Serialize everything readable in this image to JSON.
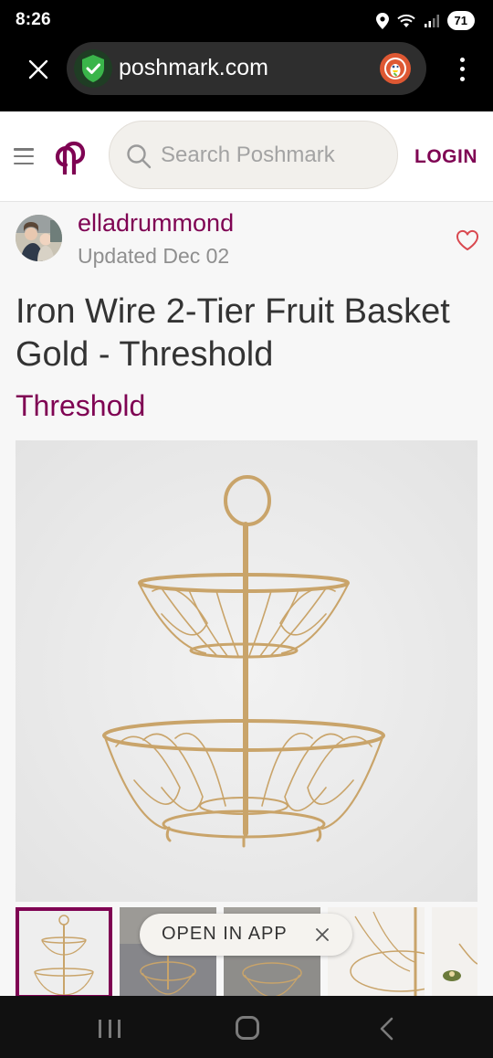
{
  "status_bar": {
    "time": "8:26",
    "battery": "71"
  },
  "browser": {
    "url": "poshmark.com"
  },
  "header": {
    "search_placeholder": "Search Poshmark",
    "login_label": "LOGIN"
  },
  "seller": {
    "username": "elladrummond",
    "updated": "Updated Dec 02"
  },
  "listing": {
    "title": "Iron Wire 2-Tier Fruit Basket Gold - Threshold",
    "brand": "Threshold"
  },
  "open_app": {
    "label": "OPEN IN APP"
  },
  "colors": {
    "brand": "#7f0353",
    "gold_wire": "#c9a46a"
  }
}
